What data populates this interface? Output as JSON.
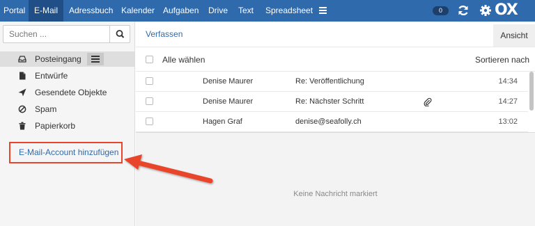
{
  "nav": {
    "items": [
      "Portal",
      "E-Mail",
      "Adressbuch",
      "Kalender",
      "Aufgaben",
      "Drive",
      "Text",
      "Spreadsheet"
    ],
    "active": "E-Mail",
    "notification_count": "0",
    "logo": "OX"
  },
  "sidebar": {
    "search_placeholder": "Suchen ...",
    "folders": [
      "Posteingang",
      "Entwürfe",
      "Gesendete Objekte",
      "Spam",
      "Papierkorb"
    ],
    "selected_folder": "Posteingang",
    "add_account_label": "E-Mail-Account hinzufügen"
  },
  "toolbar": {
    "compose_label": "Verfassen",
    "view_label": "Ansicht"
  },
  "list": {
    "select_all_label": "Alle wählen",
    "sort_label": "Sortieren nach",
    "rows": [
      {
        "from": "Denise Maurer",
        "subject": "Re: Veröffentlichung",
        "time": "14:34",
        "attachment": false
      },
      {
        "from": "Denise Maurer",
        "subject": "Re: Nächster Schritt",
        "time": "14:27",
        "attachment": true
      },
      {
        "from": "Hagen Graf",
        "subject": "denise@seafolly.ch",
        "time": "13:02",
        "attachment": false
      }
    ]
  },
  "preview": {
    "empty_text": "Keine Nachricht markiert"
  },
  "colors": {
    "topbar": "#2f6aad",
    "active_tab": "#1f4f86",
    "link": "#2f6aad",
    "highlight": "#e8452a"
  }
}
